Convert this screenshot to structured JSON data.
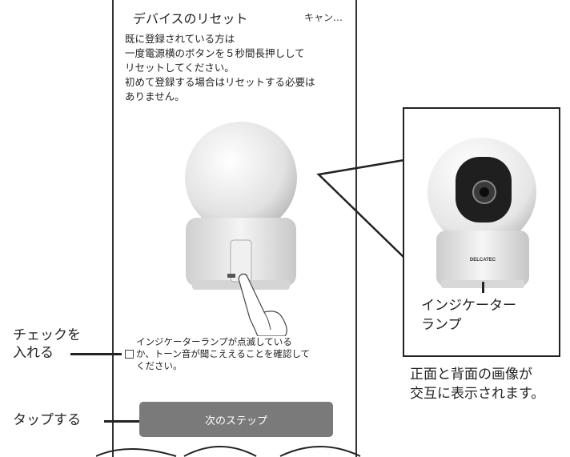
{
  "header": {
    "title": "デバイスのリセット",
    "cancel_label": "キャン…"
  },
  "instructions": [
    "既に登録されている方は",
    "一度電源横のボタンを５秒間長押しして",
    "リセットしてください。",
    "初めて登録する場合はリセットする必要は",
    "ありません。"
  ],
  "checkbox": {
    "lines": [
      "インジケーターランプが点滅している",
      "か、トーン音が聞こええることを確認して",
      "ください。"
    ],
    "checked": false
  },
  "next_button": {
    "label": "次のステップ"
  },
  "callout": {
    "brand": "DELCATEC",
    "lamp_label": [
      "インジケーター",
      "ランプ"
    ]
  },
  "note": [
    "正面と背面の画像が",
    "交互に表示されます。"
  ],
  "annotations": {
    "check": [
      "チェックを",
      "入れる"
    ],
    "tap": "タップする"
  }
}
